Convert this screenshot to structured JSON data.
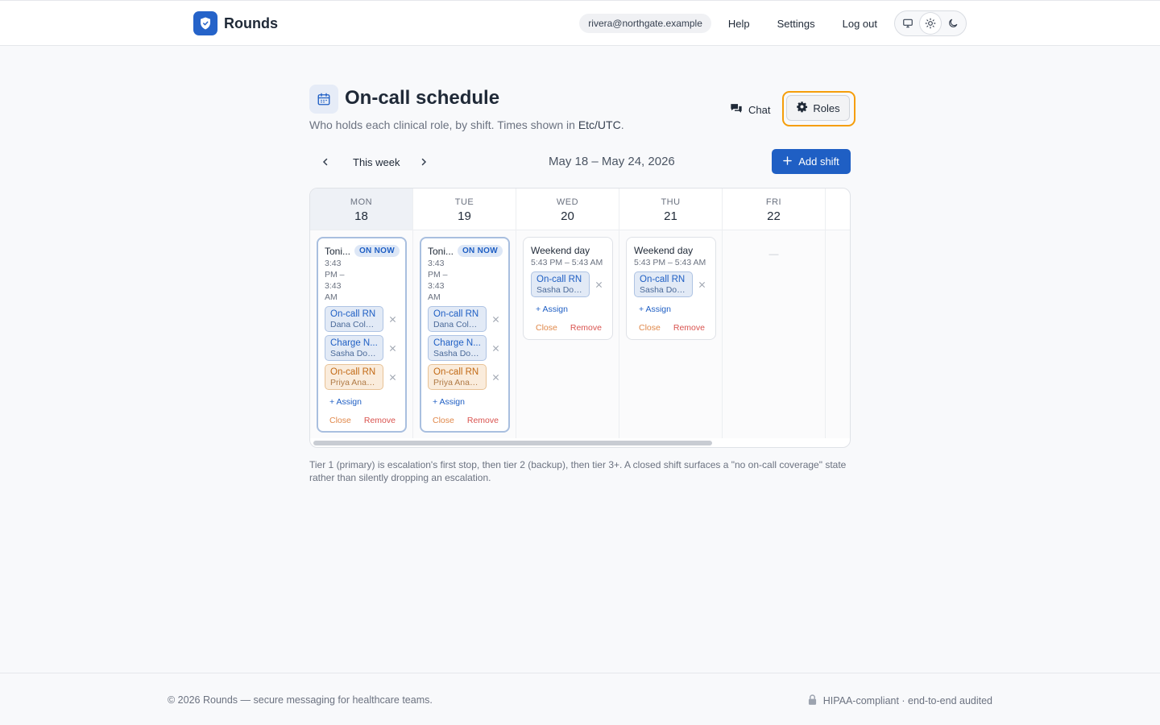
{
  "header": {
    "brand": "Rounds",
    "user_email": "rivera@northgate.example",
    "nav": {
      "help": "Help",
      "settings": "Settings",
      "logout": "Log out"
    },
    "theme_options": [
      "system",
      "light",
      "dark"
    ],
    "theme_selected": "light"
  },
  "page": {
    "title": "On-call schedule",
    "subtitle_prefix": "Who holds each clinical role, by shift. Times shown in ",
    "timezone": "Etc/UTC",
    "subtitle_suffix": ".",
    "chat_label": "Chat",
    "roles_label": "Roles"
  },
  "week": {
    "label": "This week",
    "range": "May 18 – May 24, 2026",
    "add_shift_label": "Add shift"
  },
  "days": [
    {
      "dow": "MON",
      "num": "18"
    },
    {
      "dow": "TUE",
      "num": "19"
    },
    {
      "dow": "WED",
      "num": "20"
    },
    {
      "dow": "THU",
      "num": "21"
    },
    {
      "dow": "FRI",
      "num": "22"
    }
  ],
  "shifts": {
    "mon": {
      "name": "Toni...",
      "badge": "ON NOW",
      "time": "3:43 PM – 3:43 AM",
      "assignments": [
        {
          "role": "On-call RN",
          "person": "Dana Cole, ..."
        },
        {
          "role": "Charge N...",
          "person": "Sasha Doyl..."
        },
        {
          "role": "On-call RN",
          "person": "Priya Anan..."
        }
      ],
      "assign": "+ Assign",
      "close": "Close",
      "remove": "Remove"
    },
    "tue": {
      "name": "Toni...",
      "badge": "ON NOW",
      "time": "3:43 PM – 3:43 AM",
      "assignments": [
        {
          "role": "On-call RN",
          "person": "Dana Cole, ..."
        },
        {
          "role": "Charge N...",
          "person": "Sasha Doyl..."
        },
        {
          "role": "On-call RN",
          "person": "Priya Anan..."
        }
      ],
      "assign": "+ Assign",
      "close": "Close",
      "remove": "Remove"
    },
    "wed": {
      "name": "Weekend day",
      "time": "5:43 PM – 5:43 AM",
      "assignments": [
        {
          "role": "On-call RN",
          "person": "Sasha Doyl..."
        }
      ],
      "assign": "+ Assign",
      "close": "Close",
      "remove": "Remove"
    },
    "thu": {
      "name": "Weekend day",
      "time": "5:43 PM – 5:43 AM",
      "assignments": [
        {
          "role": "On-call RN",
          "person": "Sasha Doyl..."
        }
      ],
      "assign": "+ Assign",
      "close": "Close",
      "remove": "Remove"
    },
    "fri_empty": "—"
  },
  "footnote": "Tier 1 (primary) is escalation's first stop, then tier 2 (backup), then tier 3+. A closed shift surfaces a \"no on-call coverage\" state rather than silently dropping an escalation.",
  "footer": {
    "copyright": "© 2026 Rounds — secure messaging for healthcare teams.",
    "compliance": "HIPAA-compliant · end-to-end audited"
  },
  "colors": {
    "accent": "#1f5fc4",
    "focus_ring": "#f59e0b",
    "warn_pill": "#faecdc",
    "danger": "#d9534f"
  },
  "icons": {
    "brand": "shield-icon",
    "title": "calendar-icon",
    "chat": "chat-bubbles-icon",
    "roles": "gear-icon",
    "prev": "chevron-left-icon",
    "next": "chevron-right-icon",
    "add": "plus-icon",
    "remove_assignment": "close-icon",
    "compliance": "lock-icon"
  }
}
